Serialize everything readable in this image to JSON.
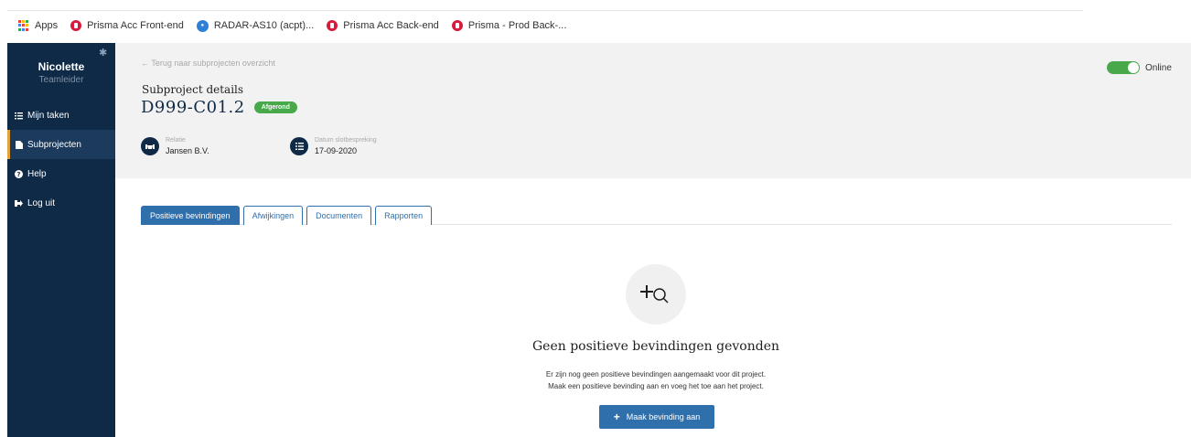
{
  "bookmarks": [
    {
      "label": "Apps",
      "icon": "apps-grid-icon"
    },
    {
      "label": "Prisma Acc Front-end",
      "icon": "prisma-icon"
    },
    {
      "label": "RADAR-AS10 (acpt)...",
      "icon": "radar-icon"
    },
    {
      "label": "Prisma Acc Back-end",
      "icon": "prisma-icon"
    },
    {
      "label": "Prisma - Prod Back-...",
      "icon": "prisma-icon"
    }
  ],
  "sidebar": {
    "user_name": "Nicolette",
    "user_role": "Teamleider",
    "items": [
      {
        "label": "Mijn taken",
        "icon": "list-icon"
      },
      {
        "label": "Subprojecten",
        "icon": "file-icon",
        "active": true
      },
      {
        "label": "Help",
        "icon": "help-icon"
      },
      {
        "label": "Log uit",
        "icon": "logout-icon"
      }
    ]
  },
  "header": {
    "back_link": "← Terug naar subprojecten overzicht",
    "subtitle": "Subproject details",
    "code": "D999-C01.2",
    "status_badge": "Afgerond",
    "relatie_label": "Relatie",
    "relatie_value": "Jansen B.V.",
    "datum_label": "Datum slotbespreking",
    "datum_value": "17-09-2020",
    "online_label": "Online"
  },
  "tabs": [
    {
      "label": "Positieve bevindingen",
      "active": true
    },
    {
      "label": "Afwijkingen"
    },
    {
      "label": "Documenten"
    },
    {
      "label": "Rapporten"
    }
  ],
  "empty_state": {
    "title": "Geen positieve bevindingen gevonden",
    "line1": "Er zijn nog geen positieve bevindingen aangemaakt voor dit project.",
    "line2": "Maak een positieve bevinding aan en voeg het toe aan het project.",
    "button_label": "Maak bevinding aan"
  },
  "colors": {
    "sidebar_bg": "#0f2a47",
    "accent_blue": "#2f6fab",
    "status_green": "#48a94b",
    "active_marker": "#e0a23b"
  }
}
